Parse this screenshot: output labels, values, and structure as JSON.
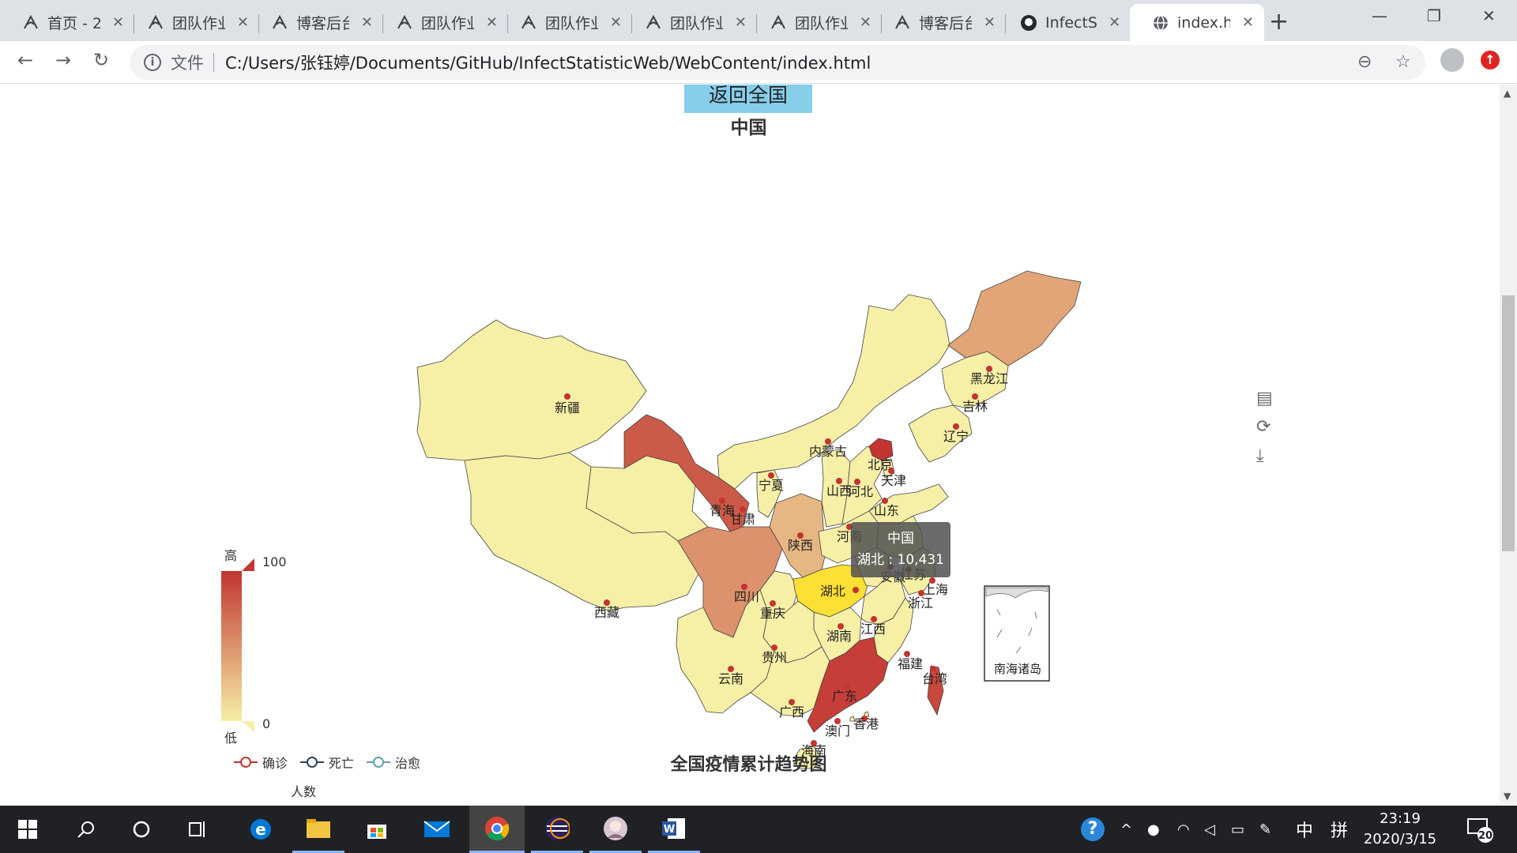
{
  "browser": {
    "tabs": [
      {
        "title": "首页 - 2",
        "icon": "cnblogs-icon"
      },
      {
        "title": "团队作业",
        "icon": "cnblogs-icon"
      },
      {
        "title": "博客后台",
        "icon": "cnblogs-icon"
      },
      {
        "title": "团队作业",
        "icon": "cnblogs-icon"
      },
      {
        "title": "团队作业",
        "icon": "cnblogs-icon"
      },
      {
        "title": "团队作业",
        "icon": "cnblogs-icon"
      },
      {
        "title": "团队作业",
        "icon": "cnblogs-icon"
      },
      {
        "title": "博客后台",
        "icon": "cnblogs-icon"
      },
      {
        "title": "InfectS",
        "icon": "github-icon"
      },
      {
        "title": "index.h",
        "icon": "globe-icon",
        "active": true
      }
    ],
    "close_glyph": "✕",
    "new_tab_glyph": "+",
    "window_controls": {
      "minimize": "—",
      "restore": "❐",
      "close": "✕"
    },
    "nav": {
      "back": "←",
      "forward": "→",
      "reload": "↻"
    },
    "address": {
      "info_glyph": "i",
      "file_label": "文件",
      "url": "C:/Users/张钰婷/Documents/GitHub/InfectStatisticWeb/WebContent/index.html"
    },
    "omnibox_right": {
      "zoom": "⊖",
      "star": "☆"
    },
    "extension_glyph": "↑"
  },
  "page": {
    "back_button": "返回全国",
    "map_title": "中国",
    "toolbox": [
      "▤",
      "⟳",
      "⤓"
    ],
    "provinces": [
      {
        "name": "新疆",
        "value": 0
      },
      {
        "name": "西藏",
        "value": 0
      },
      {
        "name": "青海",
        "value": 0
      },
      {
        "name": "甘肃",
        "value": 80
      },
      {
        "name": "内蒙古",
        "value": 0
      },
      {
        "name": "宁夏",
        "value": 0
      },
      {
        "name": "陕西",
        "value": 30
      },
      {
        "name": "山西",
        "value": 0
      },
      {
        "name": "河北",
        "value": 0
      },
      {
        "name": "北京",
        "value": 100
      },
      {
        "name": "天津",
        "value": 0
      },
      {
        "name": "辽宁",
        "value": 0
      },
      {
        "name": "吉林",
        "value": 0
      },
      {
        "name": "黑龙江",
        "value": 40
      },
      {
        "name": "山东",
        "value": 0
      },
      {
        "name": "河南",
        "value": 0
      },
      {
        "name": "四川",
        "value": 50
      },
      {
        "name": "重庆",
        "value": 0
      },
      {
        "name": "湖北",
        "value": 10431
      },
      {
        "name": "安徽",
        "value": 0
      },
      {
        "name": "江苏",
        "value": 0
      },
      {
        "name": "上海",
        "value": 90
      },
      {
        "name": "浙江",
        "value": 0
      },
      {
        "name": "湖南",
        "value": 0
      },
      {
        "name": "江西",
        "value": 0
      },
      {
        "name": "福建",
        "value": 0
      },
      {
        "name": "台湾",
        "value": 90
      },
      {
        "name": "贵州",
        "value": 0
      },
      {
        "name": "云南",
        "value": 0
      },
      {
        "name": "广西",
        "value": 0
      },
      {
        "name": "广东",
        "value": 95
      },
      {
        "name": "香港",
        "value": 0
      },
      {
        "name": "澳门",
        "value": 0
      },
      {
        "name": "海南",
        "value": 0
      }
    ],
    "south_sea_label": "南海诸岛",
    "tooltip": {
      "title": "中国",
      "text": "湖北 : 10,431"
    },
    "visual_map": {
      "high_text": "高",
      "low_text": "低",
      "max": "100",
      "min": "0",
      "color_high": "#c23531",
      "color_low": "#f6efa6",
      "highlight": "#fde034"
    },
    "trend_title": "全国疫情累计趋势图",
    "trend_legend": [
      {
        "name": "确诊",
        "color": "#c23531"
      },
      {
        "name": "死亡",
        "color": "#2f4554"
      },
      {
        "name": "治愈",
        "color": "#61a0a8"
      }
    ],
    "trend_ylabel": "人数"
  },
  "taskbar": {
    "apps": [
      "windows-start-icon",
      "search-icon",
      "cortana-icon",
      "task-view-icon",
      "edge-icon",
      "file-explorer-icon",
      "store-icon",
      "mail-icon",
      "chrome-icon",
      "eclipse-icon",
      "avatar-app-icon",
      "word-icon"
    ],
    "tray": {
      "ime_lang": "中",
      "ime_mode": "拼",
      "help": "?"
    },
    "time": "23:19",
    "date": "2020/3/15",
    "notifications": "20"
  }
}
